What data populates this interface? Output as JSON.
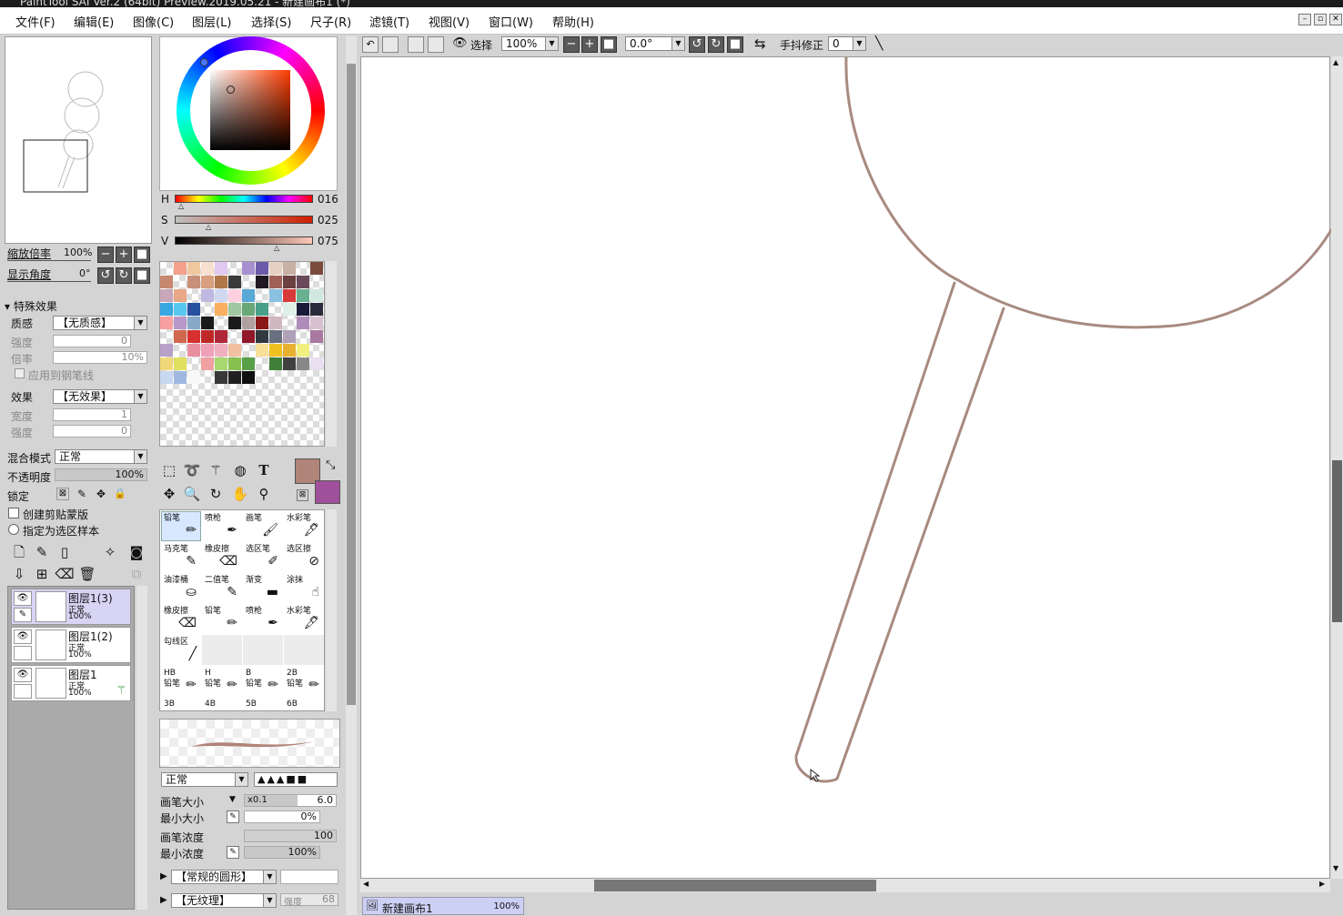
{
  "window": {
    "title": "PaintTool SAI Ver.2 (64bit) Preview.2019.05.21 - 新建画布1 (*)"
  },
  "menu": [
    "文件(F)",
    "编辑(E)",
    "图像(C)",
    "图层(L)",
    "选择(S)",
    "尺子(R)",
    "滤镜(T)",
    "视图(V)",
    "窗口(W)",
    "帮助(H)"
  ],
  "navigator": {
    "zoom_label": "缩放倍率",
    "zoom_value": "100%",
    "angle_label": "显示角度",
    "angle_value": "0°"
  },
  "effects": {
    "header": "特殊效果",
    "texture_label": "质感",
    "texture_value": "【无质感】",
    "strength_label": "强度",
    "strength_value": "0",
    "scale_label": "倍率",
    "scale_value": "10%",
    "apply_pen_label": "应用到钢笔线",
    "effect_label": "效果",
    "effect_value": "【无效果】",
    "width_label": "宽度",
    "width_value": "1",
    "strength2_label": "强度",
    "strength2_value": "0"
  },
  "layer_props": {
    "blend_label": "混合模式",
    "blend_value": "正常",
    "opacity_label": "不透明度",
    "opacity_value": "100%",
    "opacity_fraction": 1.0,
    "lock_label": "锁定",
    "clip_label": "创建剪贴蒙版",
    "select_source_label": "指定为选区样本"
  },
  "layers": [
    {
      "name": "图层1(3)",
      "mode": "正常",
      "opacity": "100%",
      "selected": true
    },
    {
      "name": "图层1(2)",
      "mode": "正常",
      "opacity": "100%",
      "selected": false
    },
    {
      "name": "图层1",
      "mode": "正常",
      "opacity": "100%",
      "selected": false
    }
  ],
  "color": {
    "h_label": "H",
    "h_value": "016",
    "s_label": "S",
    "s_value": "025",
    "v_label": "V",
    "v_value": "075",
    "primary": "#b08478",
    "secondary": "#a0509a"
  },
  "tools": [
    {
      "label": "铅笔",
      "icon": "pencil-icon",
      "selected": true
    },
    {
      "label": "喷枪",
      "icon": "airbrush-icon"
    },
    {
      "label": "画笔",
      "icon": "brush-icon"
    },
    {
      "label": "水彩笔",
      "icon": "watercolor-icon"
    },
    {
      "label": "马克笔",
      "icon": "marker-icon"
    },
    {
      "label": "橡皮擦",
      "icon": "eraser-icon"
    },
    {
      "label": "选区笔",
      "icon": "select-pen-icon"
    },
    {
      "label": "选区擦",
      "icon": "select-eraser-icon"
    },
    {
      "label": "油漆桶",
      "icon": "bucket-icon"
    },
    {
      "label": "二值笔",
      "icon": "binary-pen-icon"
    },
    {
      "label": "渐变",
      "icon": "gradient-icon"
    },
    {
      "label": "涂抹",
      "icon": "smudge-icon"
    },
    {
      "label": "橡皮擦",
      "icon": "eraser-icon"
    },
    {
      "label": "铅笔",
      "icon": "pencil-icon"
    },
    {
      "label": "喷枪",
      "icon": "airbrush-icon"
    },
    {
      "label": "水彩笔",
      "icon": "watercolor-icon"
    },
    {
      "label": "勾线区",
      "icon": "line-icon"
    },
    {
      "label": "",
      "icon": ""
    },
    {
      "label": "",
      "icon": ""
    },
    {
      "label": "",
      "icon": ""
    },
    {
      "label": "HB\n铅笔",
      "icon": "pencil-icon"
    },
    {
      "label": "H\n铅笔",
      "icon": "pencil-icon"
    },
    {
      "label": "B\n铅笔",
      "icon": "pencil-icon"
    },
    {
      "label": "2B\n铅笔",
      "icon": "pencil-icon"
    },
    {
      "label": "3B",
      "icon": ""
    },
    {
      "label": "4B",
      "icon": ""
    },
    {
      "label": "5B",
      "icon": ""
    },
    {
      "label": "6B",
      "icon": ""
    }
  ],
  "brush": {
    "mode_value": "正常",
    "size_label": "画笔大小",
    "size_mult": "x0.1",
    "size_value": "6.0",
    "min_size_label": "最小大小",
    "min_size_value": "0%",
    "density_label": "画笔浓度",
    "density_value": "100",
    "min_density_label": "最小浓度",
    "min_density_value": "100%",
    "shape_value": "【常规的圆形】",
    "texture_value": "【无纹理】",
    "texture_strength_label": "强度",
    "texture_strength_value": "68"
  },
  "canvas_toolbar": {
    "select_label": "选择",
    "zoom_value": "100%",
    "angle_value": "0.0°",
    "stabilizer_label": "手抖修正",
    "stabilizer_value": "0"
  },
  "status": {
    "doc_name": "新建画布1",
    "doc_zoom": "100%"
  },
  "colors": {
    "stroke": "#a88a80",
    "accent": "#b08478"
  }
}
